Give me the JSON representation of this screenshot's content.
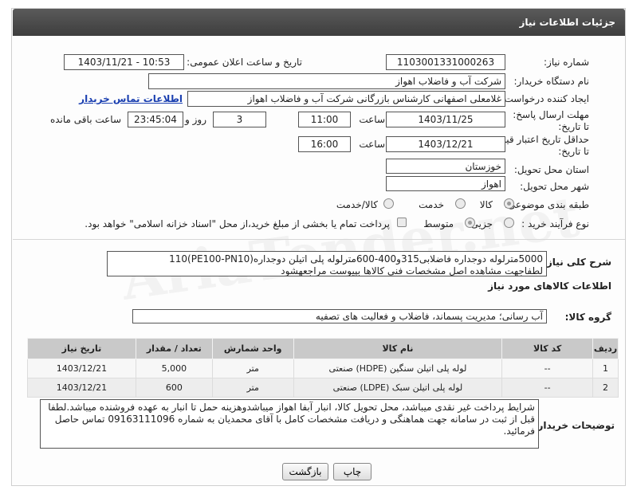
{
  "title": "جزئیات اطلاعات نیاز",
  "need_number": {
    "label": "شماره نیاز:",
    "value": "1103001331000263"
  },
  "announce_date": {
    "label": "تاریخ و ساعت اعلان عمومی:",
    "value": "1403/11/21 - 10:53"
  },
  "buyer_org": {
    "label": "نام دستگاه خریدار:",
    "value": "شرکت آب و فاضلاب اهواز"
  },
  "requester": {
    "label": "ایجاد کننده درخواست:",
    "value": "غلامعلی اصفهانی کارشناس بازرگانی شرکت آب و فاضلاب اهواز",
    "contact_link": "اطلاعات تماس خریدار"
  },
  "reply_deadline": {
    "label": "مهلت ارسال پاسخ: تا تاریخ:",
    "date": "1403/11/25",
    "time_label": "ساعت",
    "time": "11:00",
    "days": "3",
    "days_label": "روز و",
    "remaining": "23:45:04",
    "remaining_label": "ساعت باقی مانده"
  },
  "price_validity": {
    "label": "حداقل تاریخ اعتبار قیمت: تا تاریخ:",
    "date": "1403/12/21",
    "time_label": "ساعت",
    "time": "16:00"
  },
  "delivery_province": {
    "label": "استان محل تحویل:",
    "value": "خوزستان"
  },
  "delivery_city": {
    "label": "شهر محل تحویل:",
    "value": "اهواز"
  },
  "category": {
    "label": "طبقه بندی موضوعی:",
    "options": [
      "کالا",
      "خدمت",
      "کالا/خدمت"
    ],
    "selected": "کالا"
  },
  "process_type": {
    "label": "نوع فرآیند خرید :",
    "options": [
      "جزیی",
      "متوسط"
    ],
    "selected": "متوسط",
    "payment_note": "پرداخت تمام یا بخشی از مبلغ خرید،از محل \"اسناد خزانه اسلامی\" خواهد بود."
  },
  "general_desc": {
    "label": "شرح کلی نیاز:",
    "line1": "5000متر‌لوله دوجداره فاضلابی315و400-600متر‌لوله پلی اتیلن دوجداره(PE100-PN10)110",
    "line2": "لطفاجهت مشاهده اصل مشخصات فنی کالاها بپیوست مراجعهشود"
  },
  "goods_info_title": "اطلاعات کالاهای مورد نیاز",
  "goods_group": {
    "label": "گروه کالا:",
    "value": "آب رسانی؛ مدیریت پسماند، فاضلاب و فعالیت های تصفیه"
  },
  "table": {
    "headers": [
      "ردیف",
      "کد کالا",
      "نام کالا",
      "واحد شمارش",
      "تعداد / مقدار",
      "تاریخ نیاز"
    ],
    "rows": [
      [
        "1",
        "--",
        "لوله پلی اتیلن سنگین (HDPE) صنعتی",
        "متر",
        "5,000",
        "1403/12/21"
      ],
      [
        "2",
        "--",
        "لوله پلی اتیلن سبک (LDPE) صنعتی",
        "متر",
        "600",
        "1403/12/21"
      ]
    ]
  },
  "buyer_notes": {
    "label": "توضیحات خریدار:",
    "text": "شرایط پرداخت غیر نقدی میباشد، محل تحویل کالا، انبار آبفا اهواز میباشدوهزینه حمل تا انبار به عهده فروشنده میباشد.لطفا قبل از ثبت در سامانه جهت هماهنگی و دریافت مشخصات کامل با آقای  محمدیان به شماره 09163111096 تماس حاصل فرمائید."
  },
  "buttons": {
    "print": "چاپ",
    "back": "بازگشت"
  },
  "colors": {
    "header_bg": "#4a4a4a",
    "link": "#1a3fb0",
    "table_header": "#c9c9c9"
  }
}
